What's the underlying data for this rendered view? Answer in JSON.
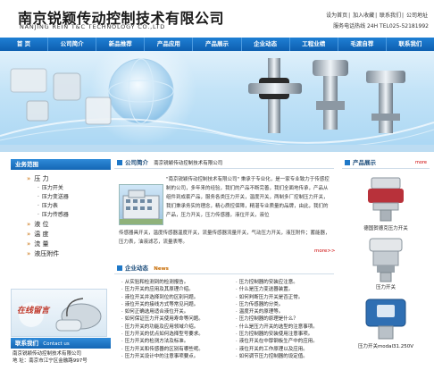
{
  "header": {
    "logo_cn": "南京锐颖传动控制技术有限公司",
    "logo_en": "NANJING REIN T&C TECHNOLOGY CO.,LTD",
    "top_links": [
      "设为首页",
      "加入收藏",
      "联系我们",
      "公司地址"
    ],
    "hotline": "服务电话热线 24H TEL025-52181992"
  },
  "nav": [
    "首 页",
    "公司简介",
    "新品推荐",
    "产品应用",
    "产品展示",
    "企业动态",
    "工程业绩",
    "毛渡自荐",
    "联系我们"
  ],
  "sidebar": {
    "title": "业务范围",
    "categories": [
      {
        "label": "压 力",
        "subs": [
          "压力开关",
          "压力变送器",
          "压力表",
          "压力传感器"
        ]
      },
      {
        "label": "液 位",
        "subs": []
      },
      {
        "label": "温 度",
        "subs": []
      },
      {
        "label": "流 量",
        "subs": []
      },
      {
        "label": "液压附件",
        "subs": []
      }
    ],
    "service_text": "在线留言",
    "contact_title": "联系我们",
    "contact_title_en": "Contact us",
    "contact_lines": [
      "南京锐颖传动控制技术有限公司",
      "地 址：南京市江宁区金融路997号"
    ]
  },
  "intro": {
    "title": "公司简介",
    "subtitle": "南京锐颖传动控制技术有限公司",
    "text": "\"南京锐颖传动控制技术有限公司\" 秉承于专业化，是一家专业致力于传感控制的公司，多年来的经验，我们的产品不断完善，我们全面地传承，产品从组件到成套产品，服务各类压力开关，温度开关，两制多厂控制压力开关，我们秉承务实的理念，精心质控保障，精湛专业质量的品牌，由此，我们的产品，压力开关，压力传感器，液位开关，液位",
    "tail": "传感器具开关，温度传感器温度开关，流量传感器流量开关，气动压力开关，液压附件；蓄能器，压力表，油液滤芯，流量表等。",
    "more": "more>>"
  },
  "news": {
    "title": "企业动态",
    "title_en": "News",
    "left": [
      "从实验和检测到的检测报告。",
      "压力开关的应用及其原理介绍。",
      "液位开关并选择到位的区别问题。",
      "液位开关的接线方式等常见问题。",
      "如何正确选用适合液位开关。",
      "如何保证压力开关使用寿命等问题。",
      "压力开关的功能及应用领域介绍。",
      "压力开关的优点如何选择型号要求。",
      "压力开关的检测方法及标准。",
      "压力开关和传感器的区别有哪些呢。",
      "压力开关设计中的注意事项要点。"
    ],
    "right": [
      "压力控制器的安装应注意。",
      "什么是压力变送器装置。",
      "如何判断压力开关是否正常。",
      "压力传感器的分类。",
      "温度开关的原理等。",
      "压力控制器的原理是什么？",
      "什么是压力开关的选型的注意事项。",
      "压力控制器的安装使用注意事项。",
      "液位开关在中厚钢板生产中的应用。",
      "液位开关的工作原理以及应用。",
      "如何调节压力控制器的设定值。"
    ]
  },
  "products": {
    "title": "产品展示",
    "more": "more",
    "items": [
      "德国贺德克压力开关",
      "压力开关",
      "压力开关modal31.250V"
    ]
  },
  "colors": {
    "nav": "#1466b4",
    "accent": "#c76a00",
    "title": "#1a4b7a"
  }
}
